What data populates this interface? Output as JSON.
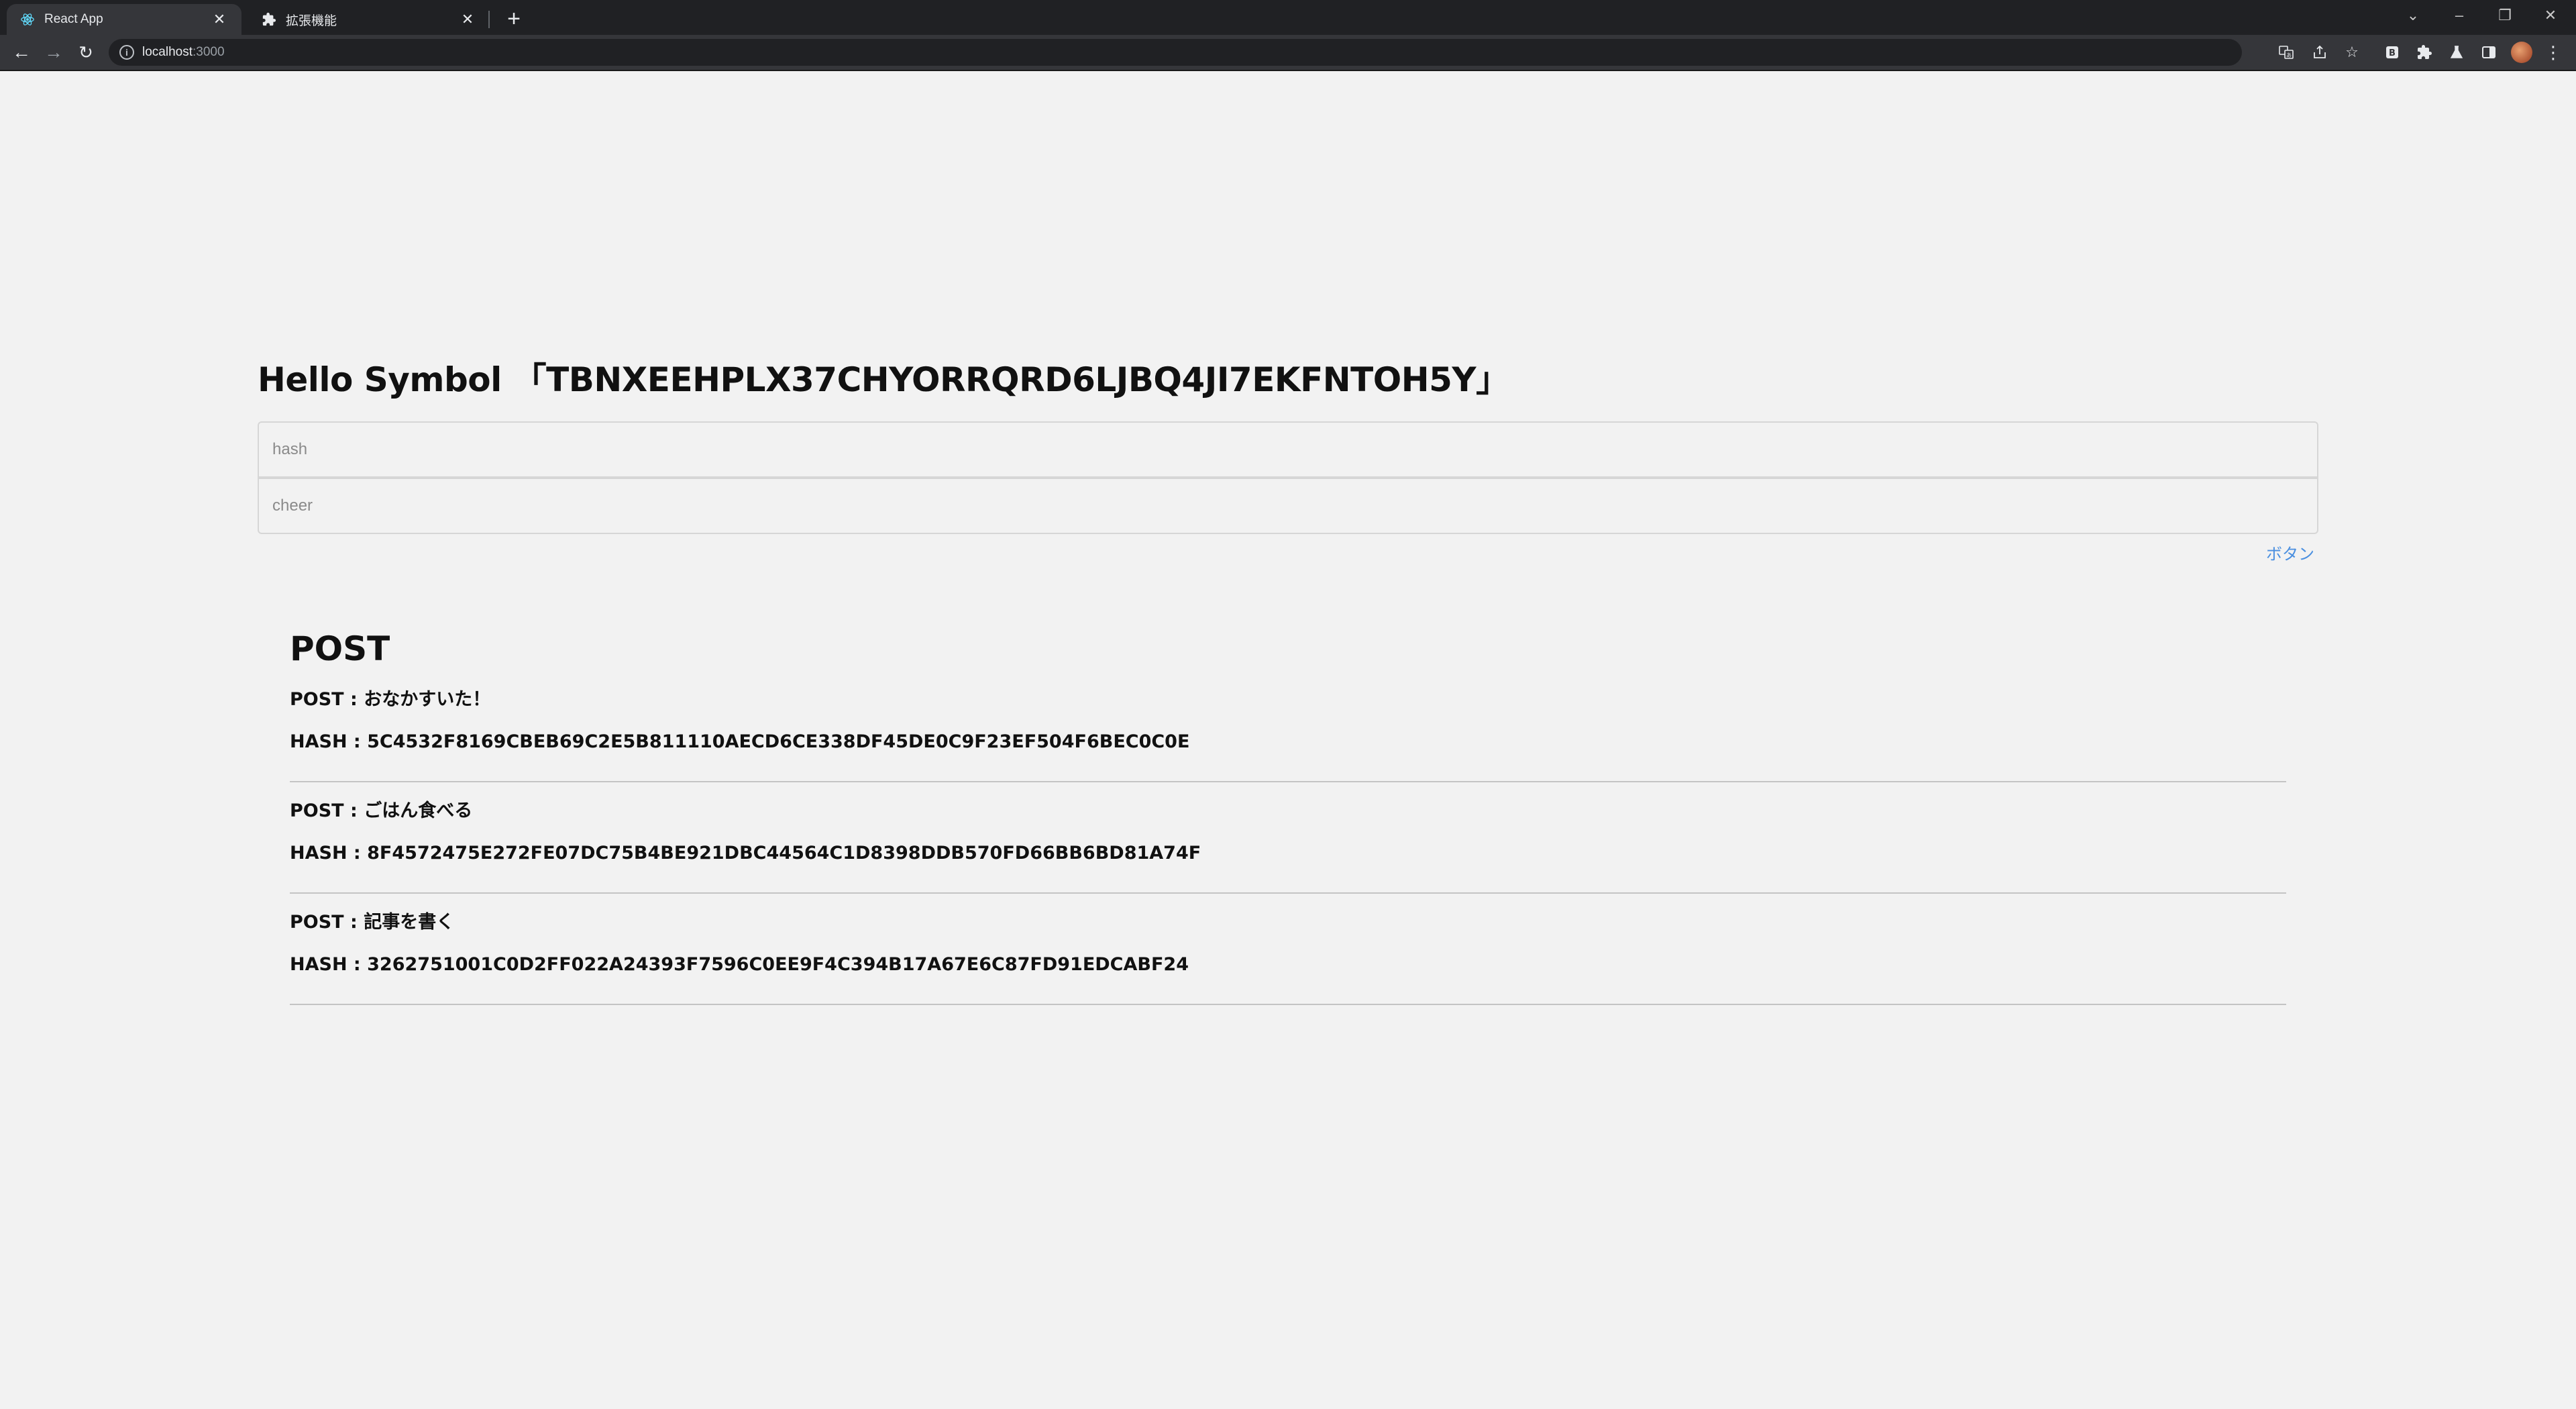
{
  "browser": {
    "tabs": [
      {
        "title": "React App",
        "favicon": "react-icon",
        "active": true
      },
      {
        "title": "拡張機能",
        "favicon": "puzzle-icon",
        "active": false
      }
    ],
    "url_host": "localhost",
    "url_port": ":3000"
  },
  "page": {
    "title": "Hello Symbol 「TBNXEEHPLX37CHYORRQRD6LJBQ4JI7EKFNTOH5Y」",
    "hash_placeholder": "hash",
    "cheer_placeholder": "cheer",
    "button_label": "ボタン"
  },
  "posts": {
    "heading": "POST",
    "items": [
      {
        "post": "POST : おなかすいた！",
        "hash": "HASH : 5C4532F8169CBEB69C2E5B811110AECD6CE338DF45DE0C9F23EF504F6BEC0C0E"
      },
      {
        "post": "POST : ごはん食べる",
        "hash": "HASH : 8F4572475E272FE07DC75B4BE921DBC44564C1D8398DDB570FD66BB6BD81A74F"
      },
      {
        "post": "POST : 記事を書く",
        "hash": "HASH : 3262751001C0D2FF022A24393F7596C0EE9F4C394B17A67E6C87FD91EDCABF24"
      }
    ]
  },
  "colors": {
    "background": "#f2f2f2",
    "link": "#4a8fe0",
    "chrome_dark": "#202124",
    "chrome_toolbar": "#35363a"
  }
}
